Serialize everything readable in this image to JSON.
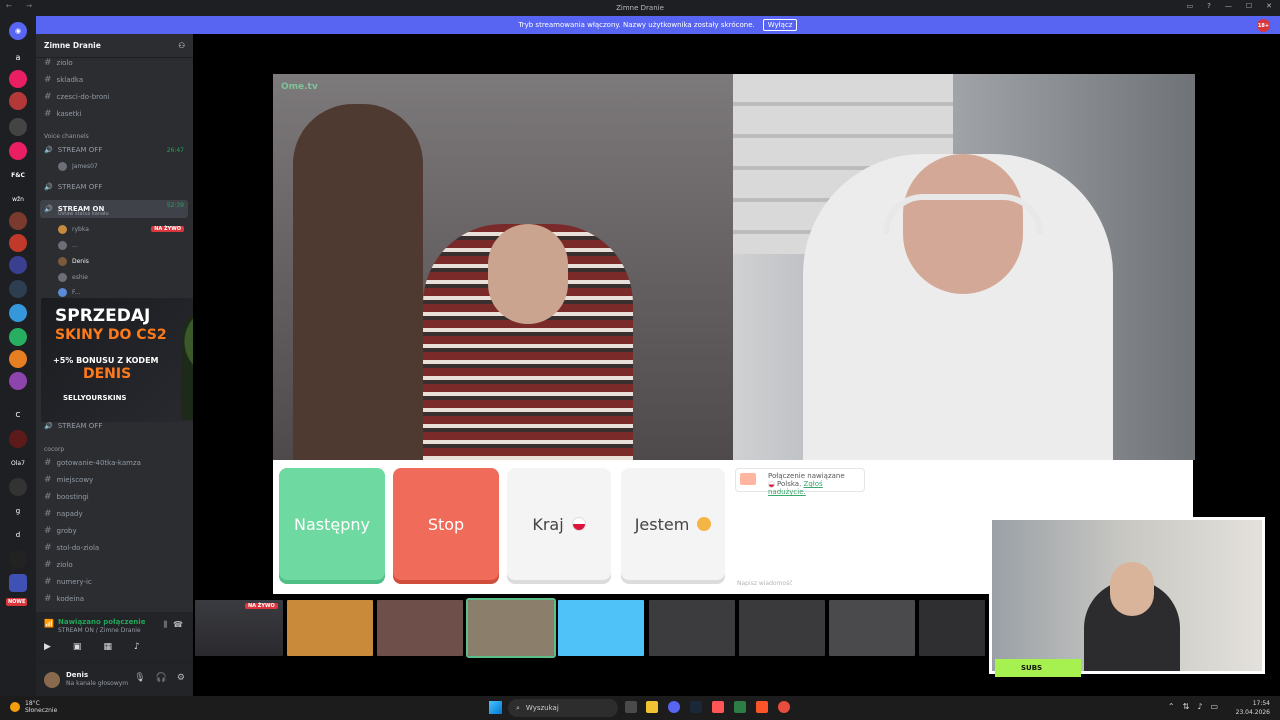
{
  "window": {
    "title": "Zimne Dranie",
    "nav_glyphs": "← →",
    "ctrl_glyphs": [
      "▭",
      "?",
      "—",
      "☐",
      "✕"
    ]
  },
  "banner": {
    "text": "Tryb streamowania włączony. Nazwy użytkownika zostały skrócone.",
    "button": "Wyłącz",
    "age_badge": "18+"
  },
  "rail": {
    "items": [
      "a",
      "F&C",
      "wžn",
      "C",
      "Ola7",
      "g",
      "d"
    ],
    "new_badge": "NOWE"
  },
  "sidebar": {
    "server_name": "Zimne Dranie",
    "text_channels_top": [
      "ziolo",
      "skladka",
      "czesci-do-broni",
      "kasetki"
    ],
    "voice_category": "Voice channels",
    "voice_channels": [
      {
        "name": "STREAM OFF",
        "timer": "26:47",
        "users": [
          "James07"
        ]
      },
      {
        "name": "STREAM OFF"
      },
      {
        "name": "STREAM ON",
        "timer": "52:39",
        "status": "Ustaw status kanału",
        "users": [
          "rybka",
          "...",
          "Denis",
          "eshie",
          "F..."
        ]
      }
    ],
    "live_label": "NA ŻYWO",
    "stream_off_after_ad": "STREAM OFF",
    "category2": "cocorp",
    "text_channels_bottom": [
      "gotowanie-40tka-kamza",
      "miejscowy",
      "boostingi",
      "napady",
      "groby",
      "stol-do-ziola",
      "ziolo",
      "numery-ic",
      "kodeina"
    ]
  },
  "ad": {
    "line1": "SPRZEDAJ",
    "line2": "SKINY DO CS2",
    "line3": "+5% BONUSU Z KODEM",
    "line4": "DENIS",
    "line5": "SELLYOURSKINS"
  },
  "voice_bar": {
    "status": "Nawiązano połączenie",
    "channel": "STREAM ON / Zimne Dranie"
  },
  "user_bar": {
    "name": "Denis",
    "status": "Na kanale głosowym"
  },
  "video": {
    "watermark": "Ome.tv"
  },
  "controls": {
    "next": "Następny",
    "stop": "Stop",
    "country": "Kraj",
    "gender": "Jestem"
  },
  "chat": {
    "message_title": "Połączenie nawiązane",
    "message_country": "Polska.",
    "report_link": "Zgłoś nadużycie.",
    "placeholder": "Napisz wiadomość"
  },
  "thumbnails": {
    "live_label": "NA ŻYWO",
    "count": 9
  },
  "pip": {
    "subs_label": "SUBS"
  },
  "taskbar": {
    "temperature": "18°C",
    "weather": "Słonecznie",
    "search": "Wyszukaj",
    "time": "17:54",
    "date": "23.04.2026"
  },
  "colors": {
    "accent": "#5865f2",
    "next_button": "#6ed9a0",
    "stop_button": "#f06b5a",
    "live_red": "#da373c",
    "online_green": "#23a55a"
  }
}
